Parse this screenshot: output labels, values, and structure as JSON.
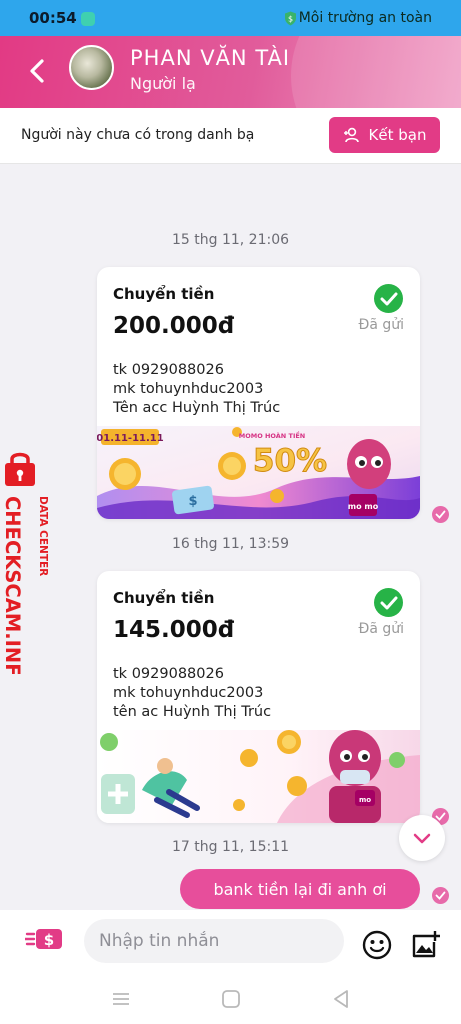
{
  "status_bar": {
    "time": "00:54",
    "safe_text": "Môi trường an toàn"
  },
  "header": {
    "name": "PHAN VĂN TÀI",
    "subtitle": "Người lạ"
  },
  "contact_bar": {
    "text": "Người này chưa có trong danh bạ",
    "add_label": "Kết bạn"
  },
  "messages": {
    "t1": "15 thg 11, 21:06",
    "t2": "16 thg 11, 13:59",
    "t3": "17 thg 11, 15:11",
    "card1": {
      "title": "Chuyển tiền",
      "amount": "200.000đ",
      "status": "Đã gửi",
      "note": [
        "tk 0929088026",
        "mk tohuynhduc2003",
        "Tên acc Huỳnh Thị Trúc"
      ],
      "banner_tag": "01.11-11.11",
      "banner_promo": "MOMO HOÀN TIỀN",
      "banner_percent": "50%",
      "banner_brand": "mo mo"
    },
    "card2": {
      "title": "Chuyển tiền",
      "amount": "145.000đ",
      "status": "Đã gửi",
      "note": [
        "tk 0929088026",
        "mk tohuynhduc2003",
        "tên ac Huỳnh Thị Trúc"
      ],
      "banner_brand": "mo"
    },
    "outgoing": "bank tiền lại đi anh ơi"
  },
  "input": {
    "placeholder": "Nhập tin nhắn"
  },
  "watermark": {
    "line1": "DATA CENTER",
    "line2": "CHECKSCAM.INFO"
  },
  "colors": {
    "pink": "#e23b86",
    "status_bar": "#2ea6ec",
    "check": "#27b347"
  }
}
